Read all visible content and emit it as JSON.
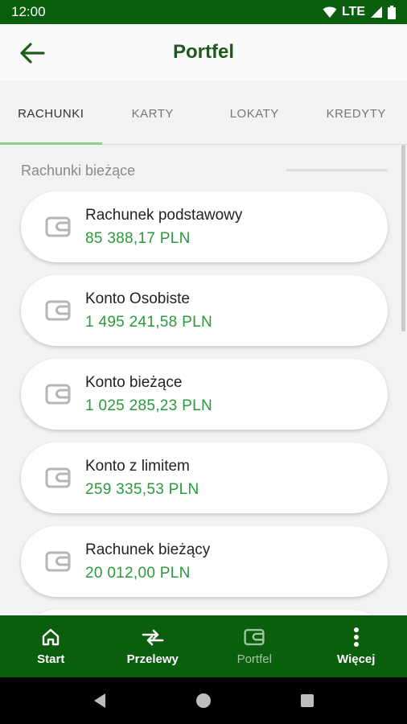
{
  "statusbar": {
    "time": "12:00",
    "network": "LTE"
  },
  "header": {
    "title": "Portfel"
  },
  "tabs": [
    {
      "label": "RACHUNKI"
    },
    {
      "label": "KARTY"
    },
    {
      "label": "LOKATY"
    },
    {
      "label": "KREDYTY"
    }
  ],
  "section": {
    "title": "Rachunki bieżące"
  },
  "accounts": [
    {
      "name": "Rachunek podstawowy",
      "amount": "85 388,17 PLN"
    },
    {
      "name": "Konto Osobiste",
      "amount": "1 495 241,58 PLN"
    },
    {
      "name": "Konto bieżące",
      "amount": "1 025 285,23 PLN"
    },
    {
      "name": "Konto z limitem",
      "amount": "259 335,53 PLN"
    },
    {
      "name": "Rachunek bieżący",
      "amount": "20 012,00 PLN"
    }
  ],
  "bottom_nav": [
    {
      "label": "Start",
      "icon": "home-icon"
    },
    {
      "label": "Przelewy",
      "icon": "transfer-icon"
    },
    {
      "label": "Portfel",
      "icon": "wallet-icon"
    },
    {
      "label": "Więcej",
      "icon": "more-icon"
    }
  ],
  "colors": {
    "brand": "#0b5e0d",
    "amount": "#2a9a3a",
    "title": "#1e5a1e",
    "active_tab_indicator": "#8cd08c"
  }
}
